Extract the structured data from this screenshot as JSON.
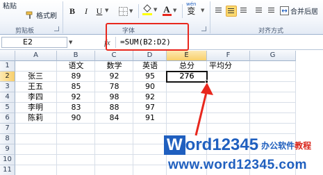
{
  "ribbon": {
    "paste_label": "粘贴",
    "format_painter_label": "格式刷",
    "clipboard_group": "剪贴板",
    "font_group": "字体",
    "alignment_group": "对齐方式",
    "merge_label": "合并后居",
    "bold": "B",
    "italic": "I",
    "underline": "U",
    "font_color_letter": "A",
    "phonetic": "wén",
    "wrap_label": "变",
    "accent_color": "#e8271d"
  },
  "formula_bar": {
    "name_box": "E2",
    "fx": "fx",
    "formula": "=SUM(B2:D2)"
  },
  "columns": [
    "A",
    "B",
    "C",
    "D",
    "E",
    "F",
    "G"
  ],
  "rows": [
    "1",
    "2",
    "3",
    "4",
    "5",
    "6",
    "7",
    "8",
    "9",
    "10",
    "11"
  ],
  "header_row": {
    "B": "语文",
    "C": "数学",
    "D": "英语",
    "E": "总分",
    "F": "平均分"
  },
  "records": [
    {
      "name": "张三",
      "chinese": "89",
      "math": "92",
      "english": "95",
      "total": "276"
    },
    {
      "name": "王五",
      "chinese": "85",
      "math": "78",
      "english": "90",
      "total": ""
    },
    {
      "name": "李四",
      "chinese": "92",
      "math": "98",
      "english": "92",
      "total": ""
    },
    {
      "name": "李明",
      "chinese": "83",
      "math": "88",
      "english": "97",
      "total": ""
    },
    {
      "name": "陈莉",
      "chinese": "90",
      "math": "84",
      "english": "91",
      "total": ""
    }
  ],
  "watermark": {
    "w_letter": "W",
    "brand": "ord12345",
    "tagline_a": "办公软件",
    "tagline_b": "教程",
    "url": "www.word12345.com"
  },
  "annotation_color": "#e8271d"
}
